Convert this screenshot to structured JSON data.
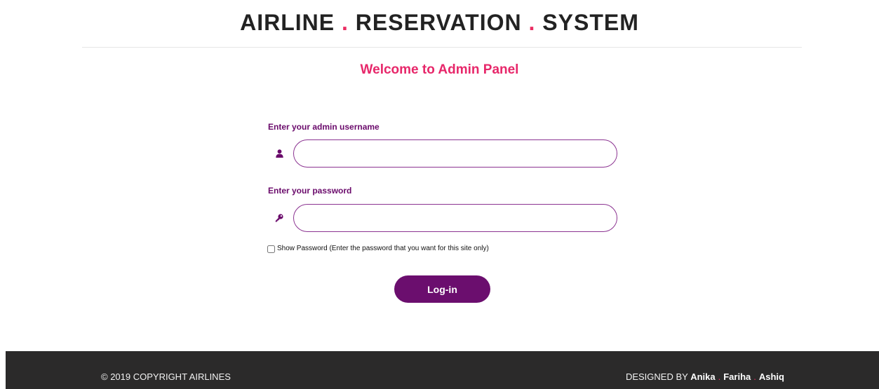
{
  "header": {
    "title_parts": [
      "AIRLINE",
      "RESERVATION",
      "SYSTEM"
    ],
    "separator": "."
  },
  "panel": {
    "title": "Welcome to Admin Panel"
  },
  "form": {
    "username_label": "Enter your admin username",
    "username_value": "",
    "password_label": "Enter your password",
    "password_value": "",
    "show_password_label": "Show Password (Enter the password that you want for this site only)",
    "show_password_checked": false,
    "login_label": "Log-in",
    "icons": {
      "username": "user-icon",
      "password": "key-icon"
    }
  },
  "footer": {
    "copyright": "© 2019 COPYRIGHT AIRLINES",
    "designed_by_label": "DESIGNED BY",
    "designers": [
      "Anika",
      "Fariha",
      "Ashiq"
    ],
    "separator": "."
  },
  "colors": {
    "accent": "#ea2c62",
    "brand_purple": "#6b0e6e",
    "footer_bg": "#2b2a2a"
  }
}
